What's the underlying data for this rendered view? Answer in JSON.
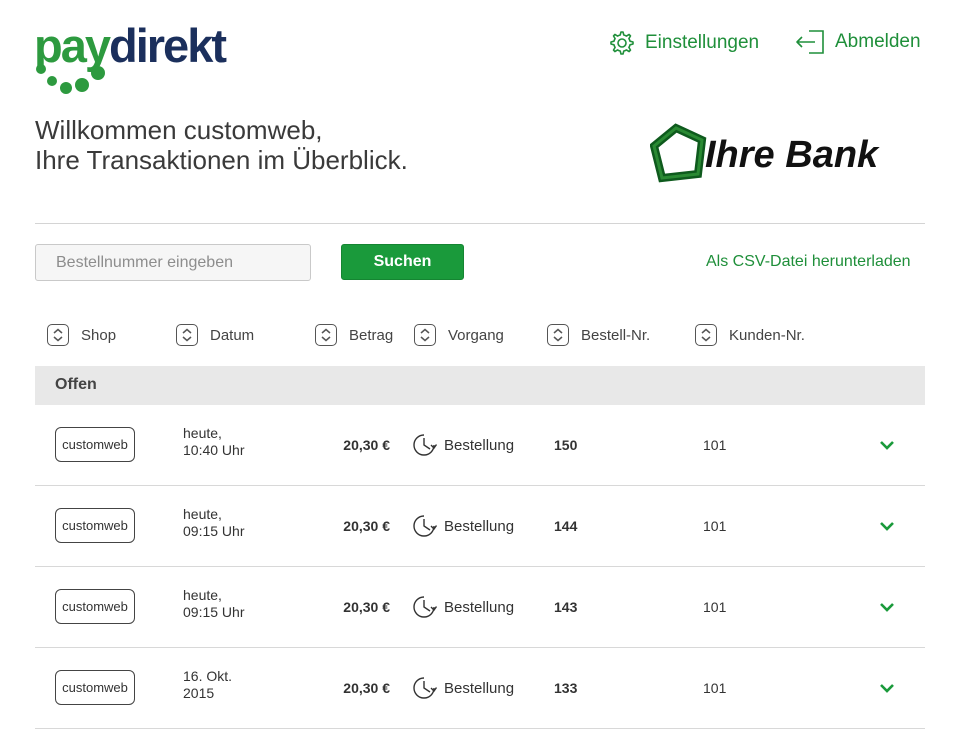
{
  "brand": {
    "logo_part1": "pay",
    "logo_part2": "direkt",
    "green": "#2d9a3f",
    "navy": "#1b2f5c"
  },
  "header": {
    "settings_label": "Einstellungen",
    "logout_label": "Abmelden"
  },
  "welcome": {
    "line1": "Willkommen customweb,",
    "line2": "Ihre Transaktionen im Überblick."
  },
  "bank": {
    "name": "Ihre Bank"
  },
  "search": {
    "placeholder": "Bestellnummer eingeben",
    "value": "",
    "button_label": "Suchen"
  },
  "csv_link": "Als CSV-Datei herunterladen",
  "columns": [
    "Shop",
    "Datum",
    "Betrag",
    "Vorgang",
    "Bestell-Nr.",
    "Kunden-Nr."
  ],
  "group": {
    "label": "Offen"
  },
  "transactions": [
    {
      "shop": "customweb",
      "date_line1": "heute,",
      "date_line2": "10:40 Uhr",
      "amount": "20,30 €",
      "vorgang": "Bestellung",
      "order_no": "150",
      "customer_no": "101"
    },
    {
      "shop": "customweb",
      "date_line1": "heute,",
      "date_line2": "09:15 Uhr",
      "amount": "20,30 €",
      "vorgang": "Bestellung",
      "order_no": "144",
      "customer_no": "101"
    },
    {
      "shop": "customweb",
      "date_line1": "heute,",
      "date_line2": "09:15 Uhr",
      "amount": "20,30 €",
      "vorgang": "Bestellung",
      "order_no": "143",
      "customer_no": "101"
    },
    {
      "shop": "customweb",
      "date_line1": "16. Okt.",
      "date_line2": "2015",
      "amount": "20,30 €",
      "vorgang": "Bestellung",
      "order_no": "133",
      "customer_no": "101"
    }
  ],
  "icons": {
    "settings": "gear-icon",
    "logout": "logout-icon",
    "sort": "sort-icon",
    "vorgang": "clock-icon",
    "expand": "chevron-down-icon"
  },
  "colors": {
    "accent": "#1f8f3a",
    "button": "#1a9a3b",
    "group_bg": "#e8e8e8"
  }
}
